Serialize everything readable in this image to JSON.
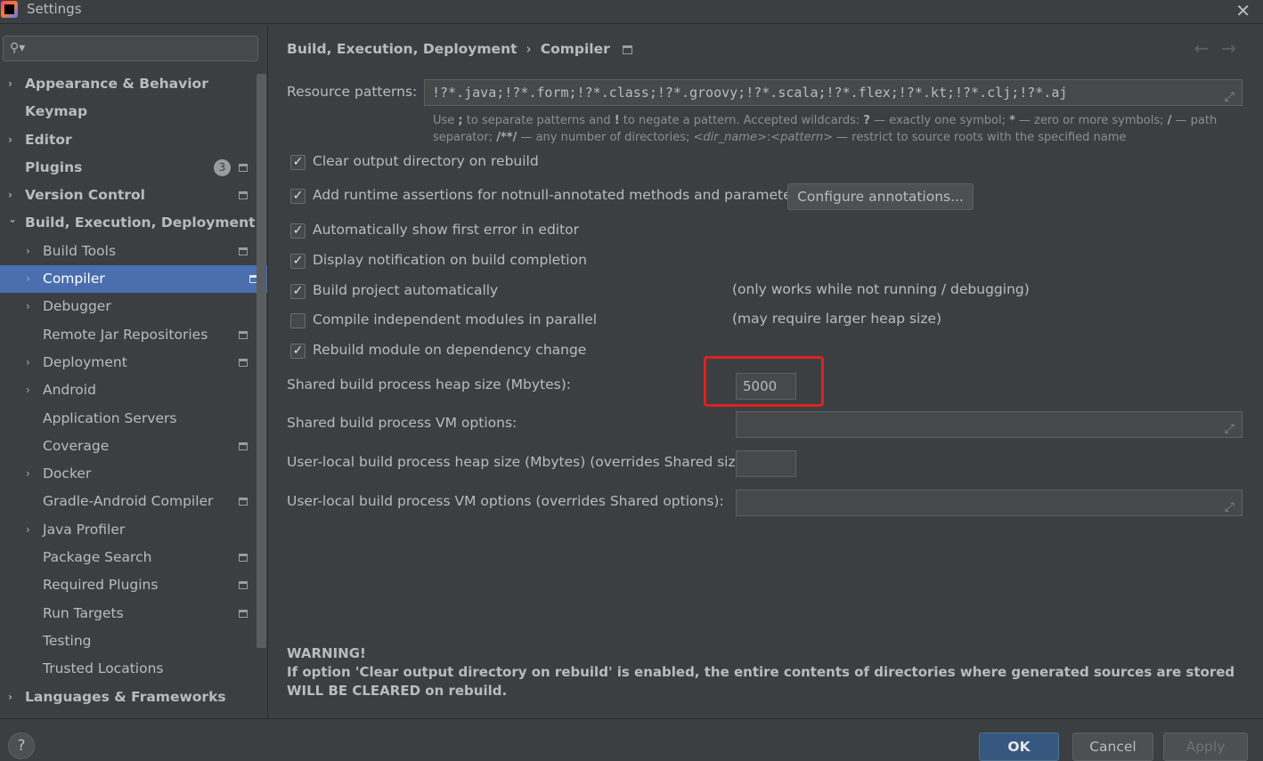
{
  "window": {
    "title": "Settings",
    "close": "✕"
  },
  "search": {
    "placeholder": "",
    "icon": "search-icon"
  },
  "tree": [
    {
      "label": "Appearance & Behavior",
      "level": 0,
      "expandable": true
    },
    {
      "label": "Keymap",
      "level": 0
    },
    {
      "label": "Editor",
      "level": 0,
      "expandable": true
    },
    {
      "label": "Plugins",
      "level": 0,
      "badge": "3",
      "project": true
    },
    {
      "label": "Version Control",
      "level": 0,
      "expandable": true,
      "project": true
    },
    {
      "label": "Build, Execution, Deployment",
      "level": 0,
      "expandable": true,
      "expanded": true
    },
    {
      "label": "Build Tools",
      "level": 1,
      "expandable": true,
      "project": true
    },
    {
      "label": "Compiler",
      "level": 1,
      "expandable": true,
      "project": true,
      "selected": true
    },
    {
      "label": "Debugger",
      "level": 1,
      "expandable": true
    },
    {
      "label": "Remote Jar Repositories",
      "level": 1,
      "project": true
    },
    {
      "label": "Deployment",
      "level": 1,
      "expandable": true,
      "project": true
    },
    {
      "label": "Android",
      "level": 1,
      "expandable": true
    },
    {
      "label": "Application Servers",
      "level": 1
    },
    {
      "label": "Coverage",
      "level": 1,
      "project": true
    },
    {
      "label": "Docker",
      "level": 1,
      "expandable": true
    },
    {
      "label": "Gradle-Android Compiler",
      "level": 1,
      "project": true
    },
    {
      "label": "Java Profiler",
      "level": 1,
      "expandable": true
    },
    {
      "label": "Package Search",
      "level": 1,
      "project": true
    },
    {
      "label": "Required Plugins",
      "level": 1,
      "project": true
    },
    {
      "label": "Run Targets",
      "level": 1,
      "project": true
    },
    {
      "label": "Testing",
      "level": 1
    },
    {
      "label": "Trusted Locations",
      "level": 1
    },
    {
      "label": "Languages & Frameworks",
      "level": 0,
      "expandable": true
    }
  ],
  "breadcrumb": {
    "parent": "Build, Execution, Deployment",
    "sep": "›",
    "current": "Compiler"
  },
  "nav": {
    "back": "←",
    "forward": "→"
  },
  "resource": {
    "label": "Resource patterns:",
    "value": "!?*.java;!?*.form;!?*.class;!?*.groovy;!?*.scala;!?*.flex;!?*.kt;!?*.clj;!?*.aj",
    "hint_html": "Use <b>;</b> to separate patterns and <b>!</b> to negate a pattern. Accepted wildcards: <b>?</b> — exactly one symbol; <b>*</b> — zero or more symbols; <b>/</b> — path separator; <b>/**/</b> — any number of directories; <i>&lt;dir_name&gt;</i>:<i>&lt;pattern&gt;</i> — restrict to source roots with the specified name"
  },
  "options": [
    {
      "label": "Clear output directory on rebuild",
      "checked": true
    },
    {
      "label": "Add runtime assertions for notnull-annotated methods and parameters",
      "checked": true
    },
    {
      "label": "Automatically show first error in editor",
      "checked": true
    },
    {
      "label": "Display notification on build completion",
      "checked": true
    },
    {
      "label": "Build project automatically",
      "checked": true,
      "note": "(only works while not running / debugging)"
    },
    {
      "label": "Compile independent modules in parallel",
      "checked": false,
      "note": "(may require larger heap size)"
    },
    {
      "label": "Rebuild module on dependency change",
      "checked": true
    }
  ],
  "configure_button": "Configure annotations...",
  "heap": {
    "label": "Shared build process heap size (Mbytes):",
    "value": "5000"
  },
  "vm_options": {
    "label": "Shared build process VM options:",
    "value": ""
  },
  "user_heap": {
    "label": "User-local build process heap size (Mbytes) (overrides Shared size):",
    "value": ""
  },
  "user_vm": {
    "label": "User-local build process VM options (overrides Shared options):",
    "value": ""
  },
  "warning": {
    "title": "WARNING!",
    "text": "If option 'Clear output directory on rebuild' is enabled, the entire contents of directories where generated sources are stored WILL BE CLEARED on rebuild."
  },
  "footer": {
    "help": "?",
    "ok": "OK",
    "cancel": "Cancel",
    "apply": "Apply"
  },
  "colors": {
    "background": "#3c3f41",
    "selection": "#4b6eaf",
    "ok_button": "#365880",
    "highlight_box": "#e0211f"
  }
}
